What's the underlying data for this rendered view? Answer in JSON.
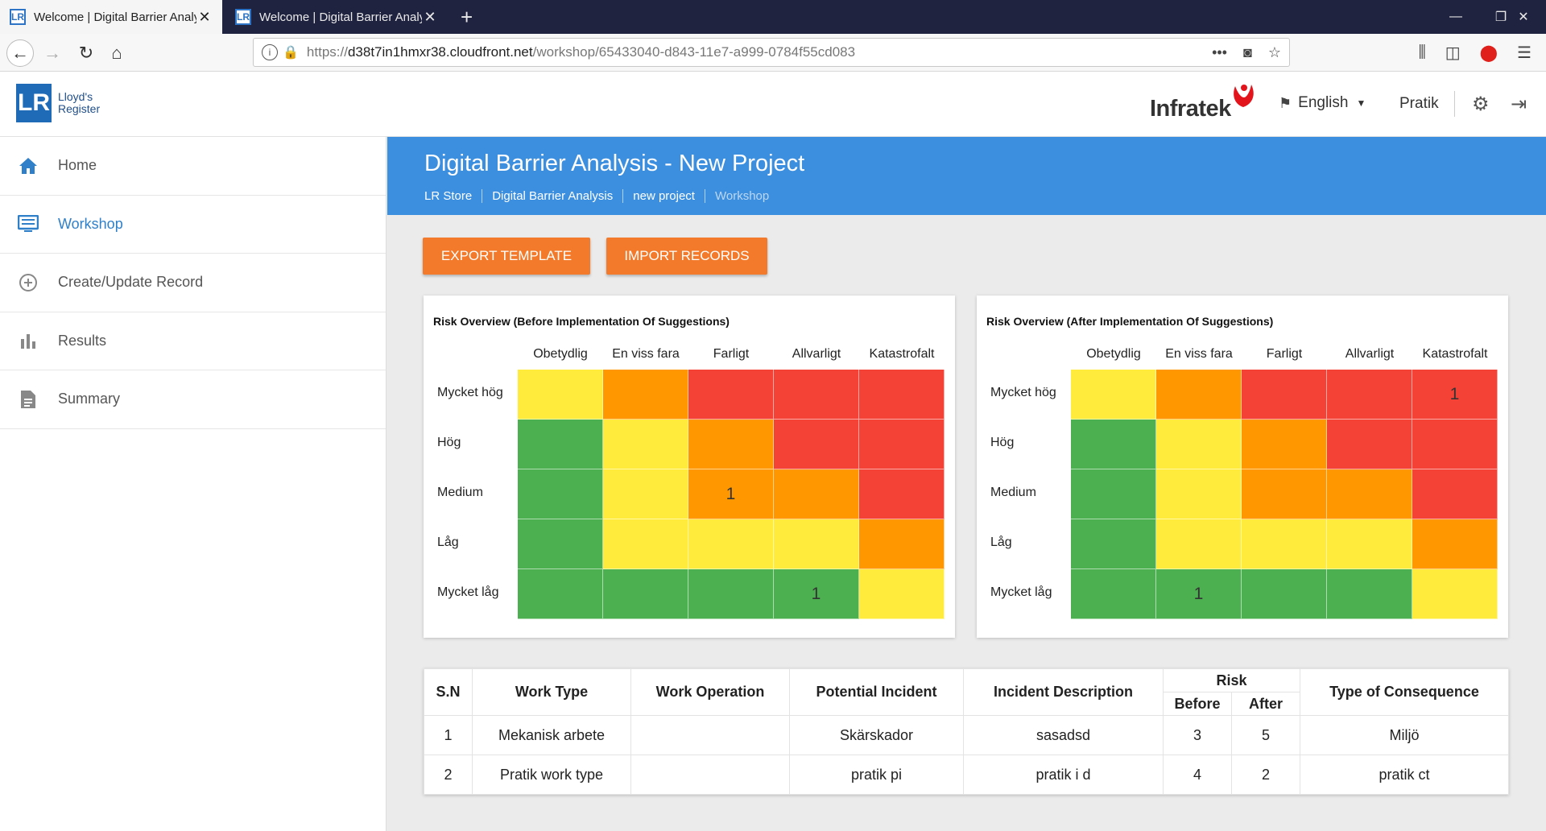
{
  "browser": {
    "tabs": [
      {
        "title": "Welcome | Digital Barrier Analy",
        "favicon": "LR"
      },
      {
        "title": "Welcome | Digital Barrier Analy",
        "favicon": "LR"
      }
    ],
    "url": {
      "scheme": "https://",
      "host": "d38t7in1hmxr38.cloudfront.net",
      "path": "/workshop/65433040-d843-11e7-a999-0784f55cd083"
    }
  },
  "header": {
    "logo_lr": "LR",
    "logo_line1": "Lloyd's",
    "logo_line2": "Register",
    "brand": "Infratek",
    "language": "English",
    "user": "Pratik"
  },
  "sidebar": {
    "items": [
      {
        "label": "Home",
        "icon": "home-icon"
      },
      {
        "label": "Workshop",
        "icon": "monitor-icon",
        "active": true
      },
      {
        "label": "Create/Update Record",
        "icon": "add-circle-icon"
      },
      {
        "label": "Results",
        "icon": "bar-chart-icon"
      },
      {
        "label": "Summary",
        "icon": "document-icon"
      }
    ]
  },
  "banner": {
    "title": "Digital Barrier Analysis - New Project",
    "breadcrumbs": [
      "LR Store",
      "Digital Barrier Analysis",
      "new project",
      "Workshop"
    ]
  },
  "actions": {
    "export": "EXPORT TEMPLATE",
    "import": "IMPORT RECORDS"
  },
  "matrix_columns": [
    "Obetydlig",
    "En viss fara",
    "Farligt",
    "Allvarligt",
    "Katastrofalt"
  ],
  "matrix_rows": [
    "Mycket hög",
    "Hög",
    "Medium",
    "Låg",
    "Mycket låg"
  ],
  "matrix_colors": [
    [
      "y",
      "o",
      "r",
      "r",
      "r"
    ],
    [
      "g",
      "y",
      "o",
      "r",
      "r"
    ],
    [
      "g",
      "y",
      "o",
      "o",
      "r"
    ],
    [
      "g",
      "y",
      "y",
      "y",
      "o"
    ],
    [
      "g",
      "g",
      "g",
      "g",
      "y"
    ]
  ],
  "palette": {
    "g": "#4caf50",
    "y": "#ffeb3b",
    "o": "#ff9800",
    "r": "#f44336"
  },
  "matrix_before": {
    "title": "Risk Overview (Before Implementation Of Suggestions)",
    "counts": [
      [
        "",
        "",
        "",
        "",
        ""
      ],
      [
        "",
        "",
        "",
        "",
        ""
      ],
      [
        "",
        "",
        "1",
        "",
        ""
      ],
      [
        "",
        "",
        "",
        "",
        ""
      ],
      [
        "",
        "",
        "",
        "1",
        ""
      ]
    ]
  },
  "matrix_after": {
    "title": "Risk Overview (After Implementation Of Suggestions)",
    "counts": [
      [
        "",
        "",
        "",
        "",
        "1"
      ],
      [
        "",
        "",
        "",
        "",
        ""
      ],
      [
        "",
        "",
        "",
        "",
        ""
      ],
      [
        "",
        "",
        "",
        "",
        ""
      ],
      [
        "",
        "1",
        "",
        "",
        ""
      ]
    ]
  },
  "table": {
    "headers": {
      "sn": "S.N",
      "work_type": "Work Type",
      "work_operation": "Work Operation",
      "potential_incident": "Potential Incident",
      "incident_description": "Incident Description",
      "risk": "Risk",
      "before": "Before",
      "after": "After",
      "consequence": "Type of Consequence"
    },
    "rows": [
      {
        "sn": "1",
        "work_type": "Mekanisk arbete",
        "work_operation": "",
        "potential_incident": "Skärskador",
        "incident_description": "sasadsd",
        "before": "3",
        "after": "5",
        "consequence": "Miljö"
      },
      {
        "sn": "2",
        "work_type": "Pratik work type",
        "work_operation": "",
        "potential_incident": "pratik pi",
        "incident_description": "pratik i d",
        "before": "4",
        "after": "2",
        "consequence": "pratik ct"
      }
    ]
  }
}
